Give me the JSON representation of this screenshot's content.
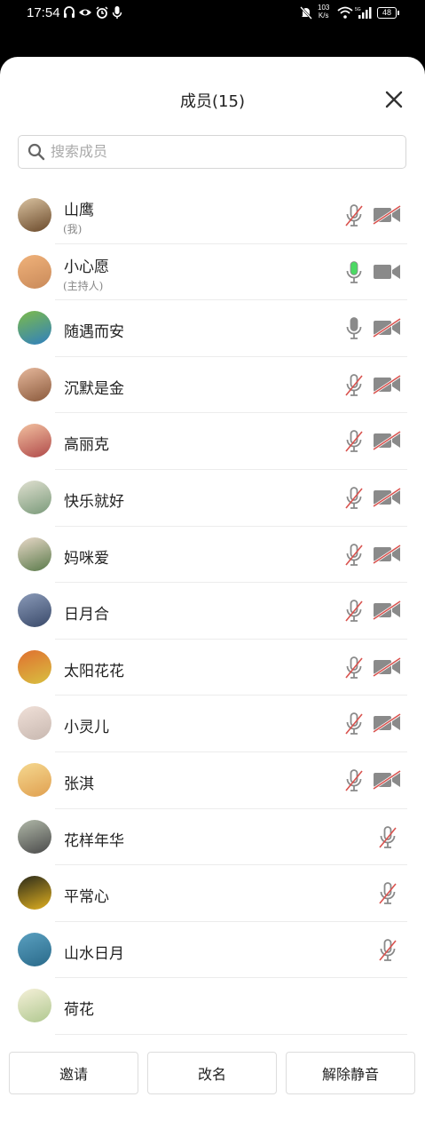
{
  "status_bar": {
    "time": "17:54",
    "net_speed_value": "103",
    "net_speed_unit": "K/s",
    "battery": "48"
  },
  "panel": {
    "title": "成员(15)",
    "search_placeholder": "搜索成员"
  },
  "members": [
    {
      "name": "山鹰",
      "role": "(我)",
      "mic": "muted",
      "cam": "off"
    },
    {
      "name": "小心愿",
      "role": "(主持人)",
      "mic": "active",
      "cam": "on"
    },
    {
      "name": "随遇而安",
      "role": "",
      "mic": "on",
      "cam": "off"
    },
    {
      "name": "沉默是金",
      "role": "",
      "mic": "muted",
      "cam": "off"
    },
    {
      "name": "高丽克",
      "role": "",
      "mic": "muted",
      "cam": "off"
    },
    {
      "name": "快乐就好",
      "role": "",
      "mic": "muted",
      "cam": "off"
    },
    {
      "name": "妈咪爱",
      "role": "",
      "mic": "muted",
      "cam": "off"
    },
    {
      "name": "日月合",
      "role": "",
      "mic": "muted",
      "cam": "off"
    },
    {
      "name": "太阳花花",
      "role": "",
      "mic": "muted",
      "cam": "off"
    },
    {
      "name": "小灵儿",
      "role": "",
      "mic": "muted",
      "cam": "off"
    },
    {
      "name": "张淇",
      "role": "",
      "mic": "muted",
      "cam": "off"
    },
    {
      "name": "花样年华",
      "role": "",
      "mic": "muted",
      "cam": "none"
    },
    {
      "name": "平常心",
      "role": "",
      "mic": "muted",
      "cam": "none"
    },
    {
      "name": "山水日月",
      "role": "",
      "mic": "muted",
      "cam": "none"
    },
    {
      "name": "荷花",
      "role": "",
      "mic": "none",
      "cam": "none"
    }
  ],
  "footer": {
    "invite_label": "邀请",
    "rename_label": "改名",
    "unmute_label": "解除静音"
  },
  "colors": {
    "muted_red": "#d9534f",
    "icon_gray": "#8a8a8a",
    "active_green": "#4cd964"
  }
}
